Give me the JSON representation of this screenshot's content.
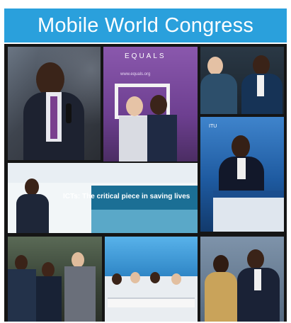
{
  "header": {
    "title": "Mobile World Congress"
  },
  "photos": [
    {
      "name": "speaker-with-microphone-photo"
    },
    {
      "name": "equals-photo-frame-photo",
      "sign_text": "EQUALS",
      "url_text": "www.equals.org"
    },
    {
      "name": "panel-discussion-photo"
    },
    {
      "name": "podium-speaker-photo",
      "screen_text": "ITU"
    },
    {
      "name": "ict-slide-speaker-photo",
      "slide_text": "ICTs: The critical piece in saving lives"
    },
    {
      "name": "group-meeting-photo"
    },
    {
      "name": "roundtable-photo"
    },
    {
      "name": "dignitaries-photo"
    }
  ]
}
